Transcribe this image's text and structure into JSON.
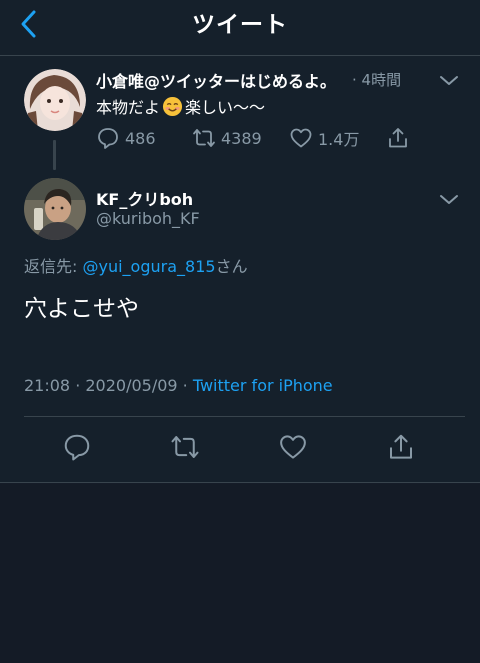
{
  "header": {
    "title": "ツイート",
    "back_icon": "chevron-left-icon"
  },
  "tweet_parent": {
    "author_name": "小倉唯@ツイッターはじめるよ。",
    "time": "· 4時間",
    "text_before_emoji": "本物だよ",
    "emoji": "smiling-face-icon",
    "text_after_emoji": "楽しい〜〜",
    "reply_count": "486",
    "retweet_count": "4389",
    "like_count": "1.4万"
  },
  "tweet_main": {
    "author_name": "KF_クリboh",
    "author_handle": "@kuriboh_KF",
    "reply_to_label": "返信先:",
    "reply_to_handle": "@yui_ogura_815",
    "reply_to_suffix": "さん",
    "text": "穴よこせや",
    "timestamp": "21:08 · 2020/05/09 · ",
    "source": "Twitter for iPhone"
  },
  "colors": {
    "background": "#15202b",
    "text": "#ffffff",
    "secondary": "#8899a6",
    "accent": "#1da1f2",
    "border": "#38444d"
  }
}
